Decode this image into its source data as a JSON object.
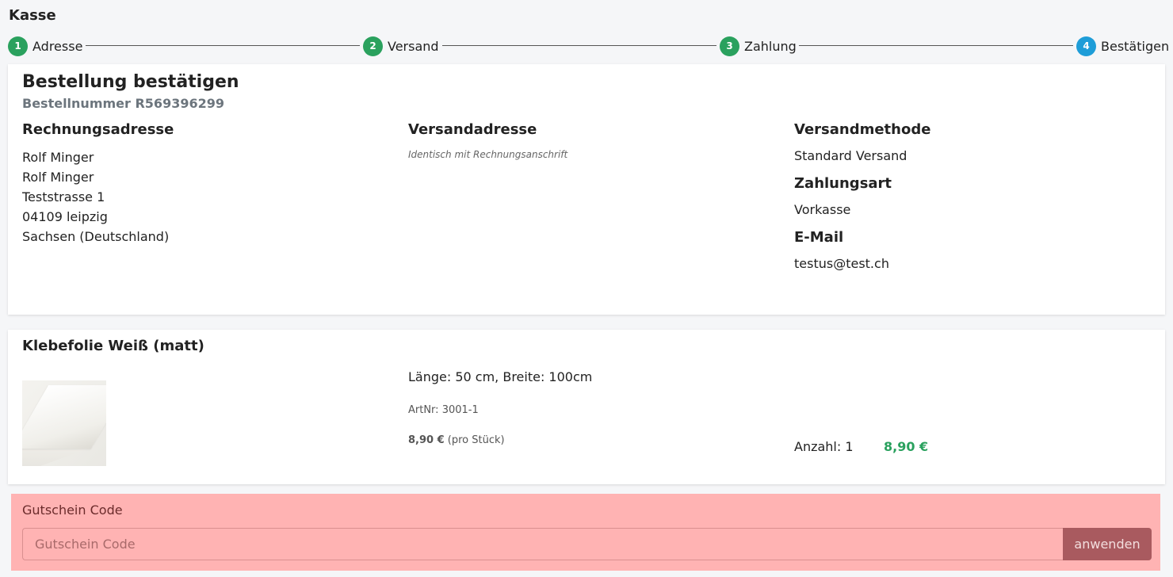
{
  "page": {
    "title": "Kasse"
  },
  "stepper": {
    "steps": [
      {
        "num": "1",
        "label": "Adresse",
        "state": "done"
      },
      {
        "num": "2",
        "label": "Versand",
        "state": "done"
      },
      {
        "num": "3",
        "label": "Zahlung",
        "state": "done"
      },
      {
        "num": "4",
        "label": "Bestätigen",
        "state": "active"
      }
    ]
  },
  "colors": {
    "done": "#2aa15e",
    "active": "#1e9dd8",
    "coupon_bg": "#ffb3b3",
    "coupon_button": "#a95a5f"
  },
  "summary": {
    "title": "Bestellung bestätigen",
    "order_number": "Bestellnummer R569396299",
    "billing": {
      "heading": "Rechnungsadresse",
      "lines": [
        "Rolf Minger",
        "Rolf Minger",
        "Teststrasse 1",
        "04109 leipzig",
        "Sachsen (Deutschland)"
      ]
    },
    "shipping_address": {
      "heading": "Versandadresse",
      "note": "Identisch mit Rechnungsanschrift"
    },
    "shipping_method": {
      "heading": "Versandmethode",
      "value": "Standard Versand"
    },
    "payment": {
      "heading": "Zahlungsart",
      "value": "Vorkasse"
    },
    "email": {
      "heading": "E-Mail",
      "value": "testus@test.ch"
    }
  },
  "item": {
    "title": "Klebefolie Weiß (matt)",
    "variant": "Länge: 50 cm, Breite: 100cm",
    "artnr": "ArtNr: 3001-1",
    "unit_price": "8,90 €",
    "unit_suffix": " (pro Stück)",
    "quantity": "Anzahl: 1",
    "total": "8,90 €"
  },
  "coupon": {
    "label": "Gutschein Code",
    "placeholder": "Gutschein Code",
    "button": "anwenden"
  }
}
